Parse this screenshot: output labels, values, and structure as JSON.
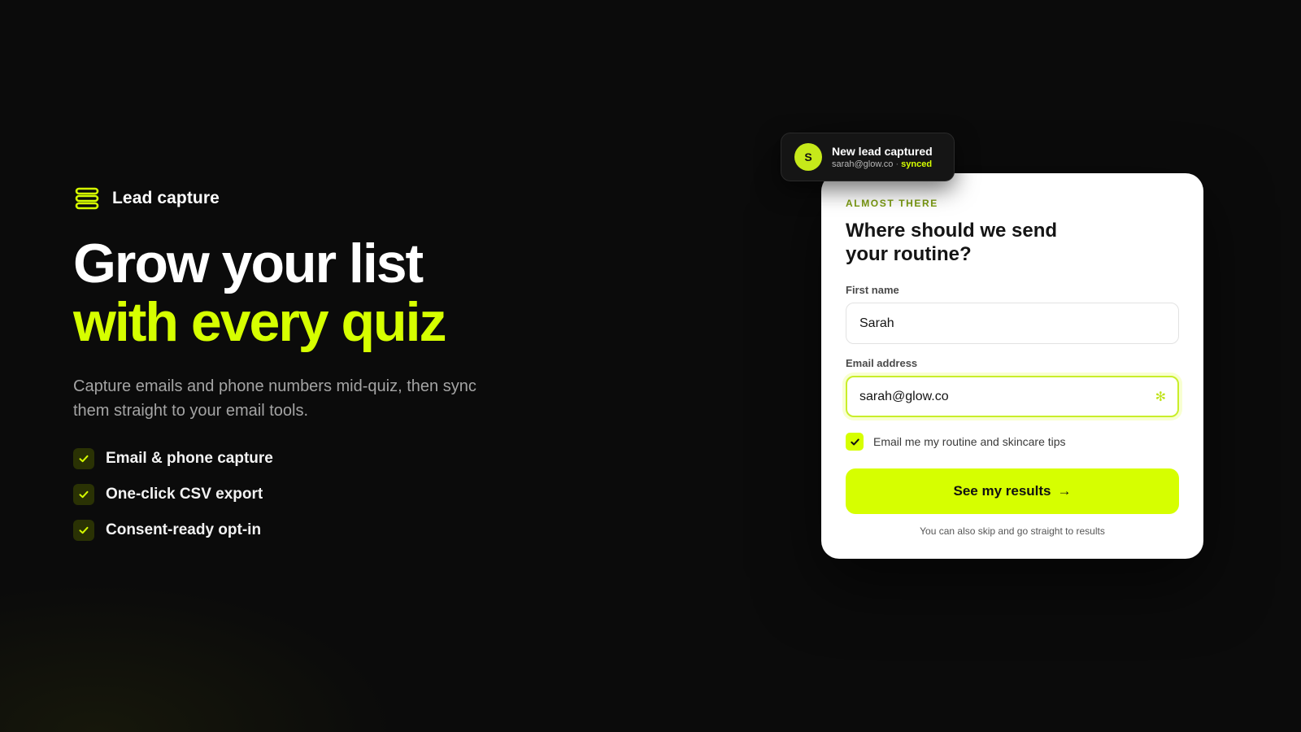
{
  "hero": {
    "eyebrow_icon": "stack-icon",
    "eyebrow_label": "Lead capture",
    "headline_line1": "Grow your list",
    "headline_line2": "with every quiz",
    "subtext": "Capture emails and phone numbers mid-quiz, then sync them straight to your email tools.",
    "features": [
      {
        "icon": "check-icon",
        "label": "Email & phone capture"
      },
      {
        "icon": "check-icon",
        "label": "One-click CSV export"
      },
      {
        "icon": "check-icon",
        "label": "Consent-ready opt-in"
      }
    ]
  },
  "toast": {
    "avatar_initial": "S",
    "title": "New lead captured",
    "email": "sarah@glow.co",
    "separator": "·",
    "status": "synced"
  },
  "form": {
    "eyebrow": "ALMOST THERE",
    "title": "Where should we send your routine?",
    "first_name": {
      "label": "First name",
      "value": "Sarah"
    },
    "email": {
      "label": "Email address",
      "value": "sarah@glow.co",
      "status_icon": "sparkle-icon",
      "status_glyph": "✻"
    },
    "consent": {
      "checked": true,
      "label": "Email me my routine and skincare tips"
    },
    "cta": {
      "label": "See my results",
      "arrow": "→"
    },
    "skip_text": "You can also skip and go straight to results"
  },
  "colors": {
    "accent": "#d6ff00",
    "background": "#0b0b0b",
    "card": "#ffffff",
    "eyebrow_green": "#7a9a10"
  }
}
